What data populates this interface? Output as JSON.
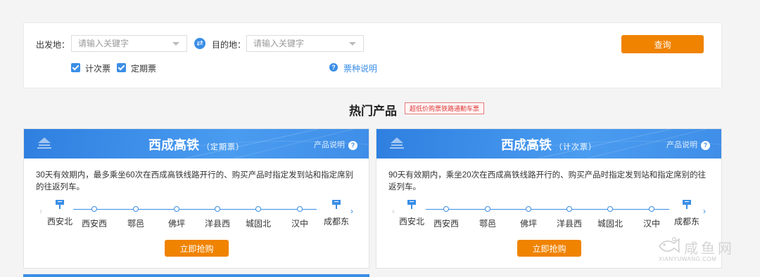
{
  "search": {
    "from_label": "出发地：",
    "from_placeholder": "请输入关键字",
    "to_label": "目的地：",
    "to_placeholder": "请输入关键字",
    "query_label": "查询",
    "ticket_types": [
      {
        "label": "计次票",
        "checked": true
      },
      {
        "label": "定期票",
        "checked": true
      }
    ],
    "help_label": "票种说明"
  },
  "hot": {
    "title": "热门产品",
    "tag": "超低价购票铁路通勤车票"
  },
  "cards": [
    {
      "name": "西成高铁",
      "type": "（定期票）",
      "help": "产品说明",
      "desc": "30天有效期内，最多乘坐60次在西成高铁线路开行的、购买产品时指定发到站和指定席别的往返列车。",
      "stations": [
        "西安北",
        "西安西",
        "鄠邑",
        "佛坪",
        "洋县西",
        "城固北",
        "汉中",
        "成都东"
      ],
      "buy": "立即抢购"
    },
    {
      "name": "西成高铁",
      "type": "（计次票）",
      "help": "产品说明",
      "desc": "90天有效期内，乘坐20次在西成高铁线路开行的、购买产品时指定发到站和指定席别的往返列车。",
      "stations": [
        "西安北",
        "西安西",
        "鄠邑",
        "佛坪",
        "洋县西",
        "城固北",
        "汉中",
        "成都东"
      ],
      "buy": "立即抢购"
    }
  ],
  "watermark": {
    "cn": "咸鱼网",
    "en": "XIANYUWANG.COM"
  },
  "colors": {
    "accent": "#3a8ee6",
    "button": "#f08300"
  }
}
